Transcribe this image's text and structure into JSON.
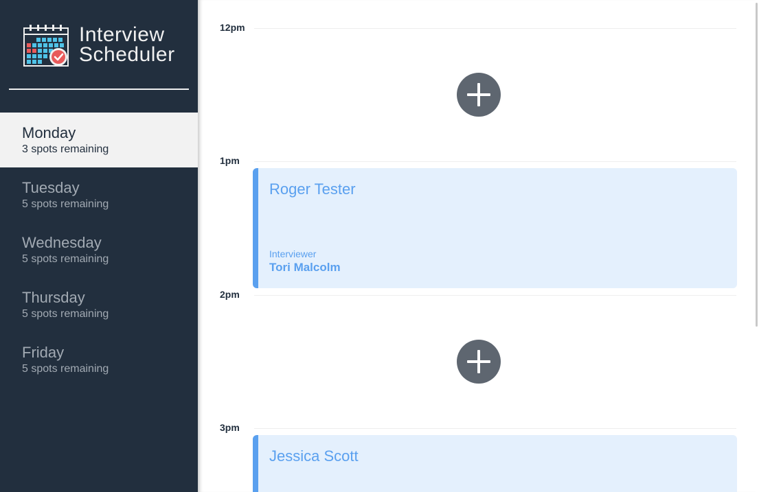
{
  "app": {
    "title_line1": "Interview",
    "title_line2": "Scheduler",
    "logo_icon": "calendar-check-icon"
  },
  "days": [
    {
      "name": "Monday",
      "spots": "3 spots remaining",
      "selected": true
    },
    {
      "name": "Tuesday",
      "spots": "5 spots remaining",
      "selected": false
    },
    {
      "name": "Wednesday",
      "spots": "5 spots remaining",
      "selected": false
    },
    {
      "name": "Thursday",
      "spots": "5 spots remaining",
      "selected": false
    },
    {
      "name": "Friday",
      "spots": "5 spots remaining",
      "selected": false
    }
  ],
  "schedule": {
    "slots": [
      {
        "time": "12pm",
        "state": "empty",
        "icon": "plus-icon"
      },
      {
        "time": "1pm",
        "state": "booked",
        "student": "Roger Tester",
        "interviewer_label": "Interviewer",
        "interviewer": "Tori Malcolm"
      },
      {
        "time": "2pm",
        "state": "empty",
        "icon": "plus-icon"
      },
      {
        "time": "3pm",
        "state": "booked",
        "student": "Jessica Scott"
      }
    ]
  },
  "colors": {
    "sidebar": "#222f3e",
    "selected_day": "#f2f2f2",
    "appointment_bg": "#e4f0fd",
    "appointment_accent": "#5aa0ef",
    "add_button": "#5e6670"
  }
}
